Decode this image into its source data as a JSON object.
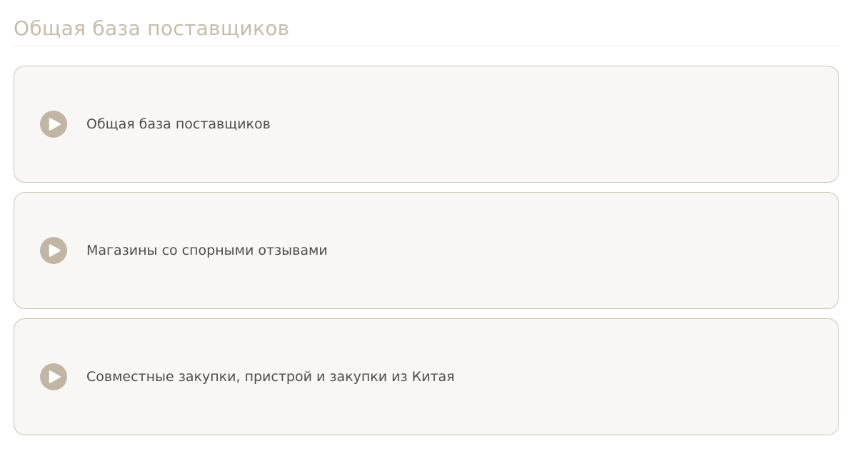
{
  "header": {
    "title": "Общая база поставщиков"
  },
  "cards": [
    {
      "label": "Общая база поставщиков",
      "icon": "play-icon"
    },
    {
      "label": "Магазины со спорными отзывами",
      "icon": "play-icon"
    },
    {
      "label": "Совместные закупки, пристрой и закупки из Китая",
      "icon": "play-icon"
    }
  ],
  "colors": {
    "accent": "#c0b6a3",
    "title": "#c6bcaa",
    "card_background": "#f8f7f5",
    "card_border": "#c9c4b4",
    "text": "#4d4d4d"
  }
}
